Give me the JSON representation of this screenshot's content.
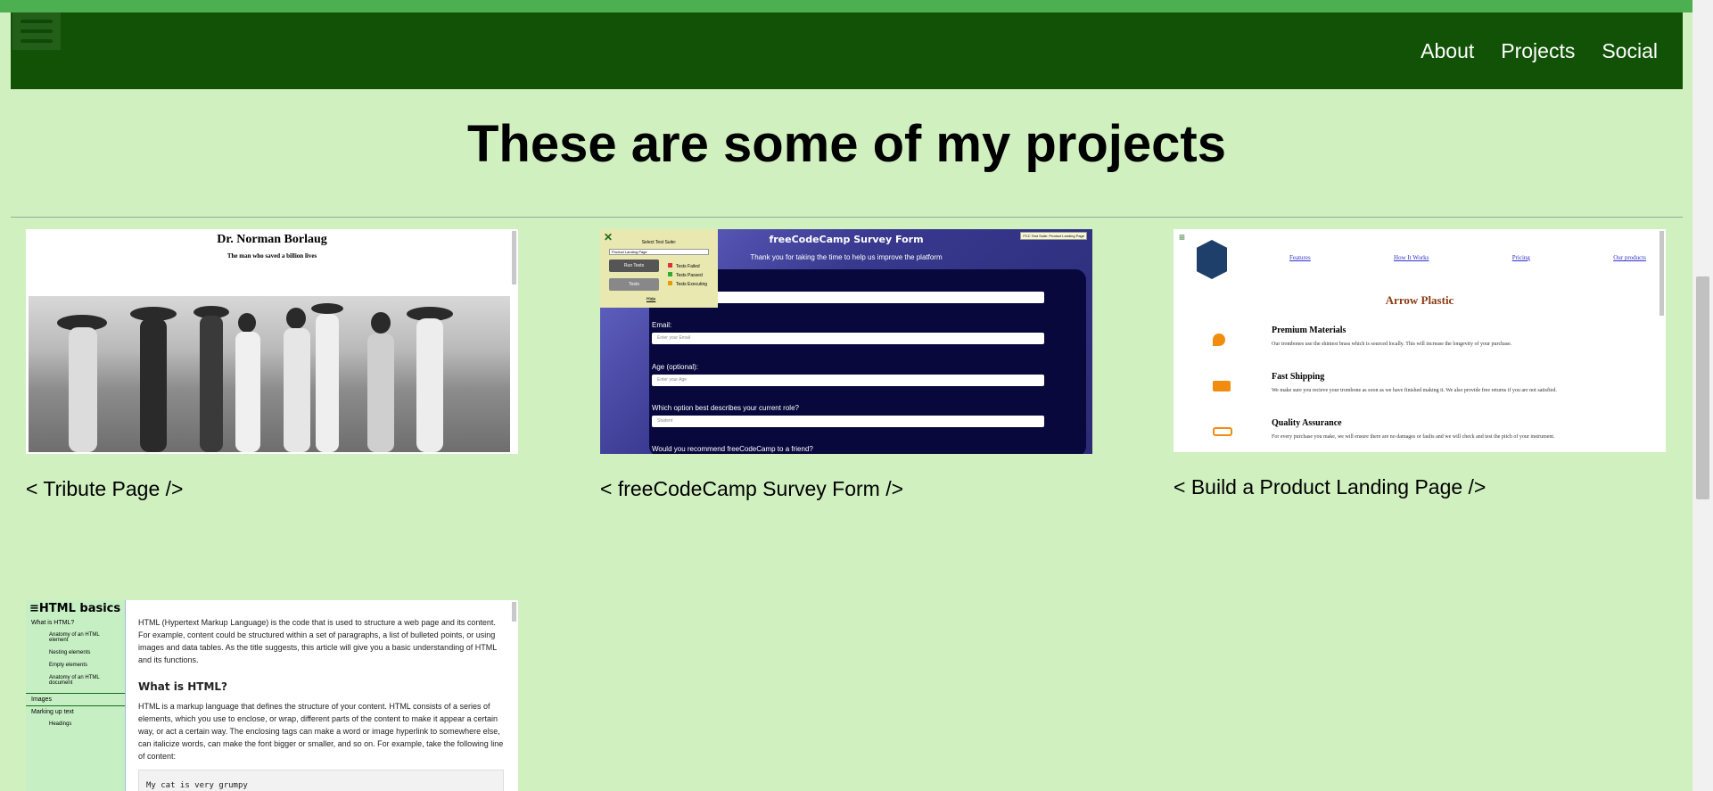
{
  "nav": {
    "links": [
      "About",
      "Projects",
      "Social"
    ]
  },
  "page_title": "These are some of my projects",
  "projects": [
    {
      "caption": "< Tribute Page />",
      "thumb": {
        "title": "Dr. Norman Borlaug",
        "subtitle": "The man who saved a billion lives"
      }
    },
    {
      "caption": "< freeCodeCamp Survey Form />",
      "thumb": {
        "heading": "freeCodeCamp Survey Form",
        "tagline": "Thank you for taking the time to help us improve the platform",
        "email_label": "Email:",
        "email_placeholder": "Enter your Email",
        "age_label": "Age (optional):",
        "age_placeholder": "Enter your Age",
        "role_label": "Which option best describes your current role?",
        "role_value": "Student",
        "recommend_label": "Would you recommend freeCodeCamp to a friend?",
        "tests_title": "Select Test Suite:",
        "tests_suite": "Product Landing Page",
        "run_tests": "Run Tests",
        "tests_btn": "Tests",
        "legend": [
          "Tests Failed",
          "Tests Passed",
          "Tests Executing"
        ],
        "hide": "Hide",
        "badge": "FCC Test Suite: Product Landing Page"
      }
    },
    {
      "caption": "< Build a Product Landing Page />",
      "thumb": {
        "nav": [
          "Features",
          "How It Works",
          "Pricing",
          "Our products"
        ],
        "title": "Arrow Plastic",
        "features": [
          {
            "title": "Premium Materials",
            "body": "Our trombones use the shiniest brass which is sourced locally. This will increase the longevity of your purchase."
          },
          {
            "title": "Fast Shipping",
            "body": "We make sure you recieve your trombone as soon as we have finished making it. We also provide free returns if you are not satisfied."
          },
          {
            "title": "Quality Assurance",
            "body": "For every purchase you make, we will ensure there are no damages or faults and we will check and test the pitch of your instrument."
          }
        ]
      }
    },
    {
      "caption": "",
      "thumb": {
        "side_title": "HTML basics",
        "side_items": [
          "What is HTML?",
          "Anatomy of an HTML element",
          "Nesting elements",
          "Empty elements",
          "Anatomy of an HTML document",
          "Images",
          "Marking up text",
          "Headings"
        ],
        "intro": "HTML (Hypertext Markup Language) is the code that is used to structure a web page and its content. For example, content could be structured within a set of paragraphs, a list of bulleted points, or using images and data tables. As the title suggests, this article will give you a basic understanding of HTML and its functions.",
        "heading": "What is HTML?",
        "body": "HTML is a markup language that defines the structure of your content. HTML consists of a series of elements, which you use to enclose, or wrap, different parts of the content to make it appear a certain way, or act a certain way. The enclosing tags can make a word or image hyperlink to somewhere else, can italicize words, can make the font bigger or smaller, and so on. For example, take the following line of content:",
        "code": "My cat is very grumpy"
      }
    }
  ]
}
